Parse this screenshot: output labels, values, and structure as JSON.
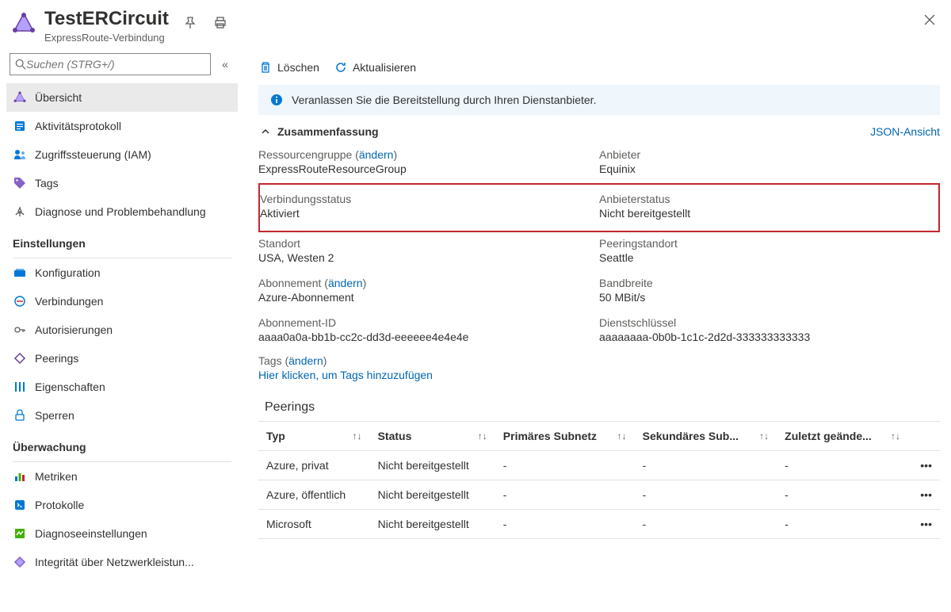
{
  "header": {
    "title": "TestERCircuit",
    "subtitle": "ExpressRoute-Verbindung"
  },
  "search": {
    "placeholder": "Suchen (STRG+/)"
  },
  "sidebar": {
    "group_main": [
      {
        "label": "Übersicht"
      },
      {
        "label": "Aktivitätsprotokoll"
      },
      {
        "label": "Zugriffssteuerung (IAM)"
      },
      {
        "label": "Tags"
      },
      {
        "label": "Diagnose und Problembehandlung"
      }
    ],
    "sections": [
      {
        "title": "Einstellungen",
        "items": [
          {
            "label": "Konfiguration"
          },
          {
            "label": "Verbindungen"
          },
          {
            "label": "Autorisierungen"
          },
          {
            "label": "Peerings"
          },
          {
            "label": "Eigenschaften"
          },
          {
            "label": "Sperren"
          }
        ]
      },
      {
        "title": "Überwachung",
        "items": [
          {
            "label": "Metriken"
          },
          {
            "label": "Protokolle"
          },
          {
            "label": "Diagnoseeinstellungen"
          },
          {
            "label": "Integrität über Netzwerkleistun..."
          }
        ]
      }
    ]
  },
  "toolbar": {
    "delete": "Löschen",
    "refresh": "Aktualisieren"
  },
  "info": {
    "text": "Veranlassen Sie die Bereitstellung durch Ihren Dienstanbieter."
  },
  "summary": {
    "header": "Zusammenfassung",
    "json_view": "JSON-Ansicht",
    "change": "ändern",
    "left": {
      "rg_label": "Ressourcengruppe",
      "rg_value": "ExpressRouteResourceGroup",
      "conn_status_label": "Verbindungsstatus",
      "conn_status_value": "Aktiviert",
      "location_label": "Standort",
      "location_value": "USA, Westen 2",
      "sub_label": "Abonnement",
      "sub_value": "Azure-Abonnement",
      "sub_id_label": "Abonnement-ID",
      "sub_id_value": "aaaa0a0a-bb1b-cc2c-dd3d-eeeeee4e4e4e"
    },
    "right": {
      "provider_label": "Anbieter",
      "provider_value": "Equinix",
      "provider_status_label": "Anbieterstatus",
      "provider_status_value": "Nicht bereitgestellt",
      "peering_loc_label": "Peeringstandort",
      "peering_loc_value": "Seattle",
      "bandwidth_label": "Bandbreite",
      "bandwidth_value": "50 MBit/s",
      "service_key_label": "Dienstschlüssel",
      "service_key_value": "aaaaaaaa-0b0b-1c1c-2d2d-333333333333"
    },
    "tags_label": "Tags",
    "tags_add": "Hier klicken, um Tags hinzuzufügen"
  },
  "peerings": {
    "title": "Peerings",
    "cols": {
      "type": "Typ",
      "status": "Status",
      "primary": "Primäres Subnetz",
      "secondary": "Sekundäres Sub...",
      "last": "Zuletzt geände..."
    },
    "rows": [
      {
        "type": "Azure, privat",
        "status": "Nicht bereitgestellt",
        "primary": "-",
        "secondary": "-",
        "last": "-"
      },
      {
        "type": "Azure, öffentlich",
        "status": "Nicht bereitgestellt",
        "primary": "-",
        "secondary": "-",
        "last": "-"
      },
      {
        "type": "Microsoft",
        "status": "Nicht bereitgestellt",
        "primary": "-",
        "secondary": "-",
        "last": "-"
      }
    ]
  }
}
